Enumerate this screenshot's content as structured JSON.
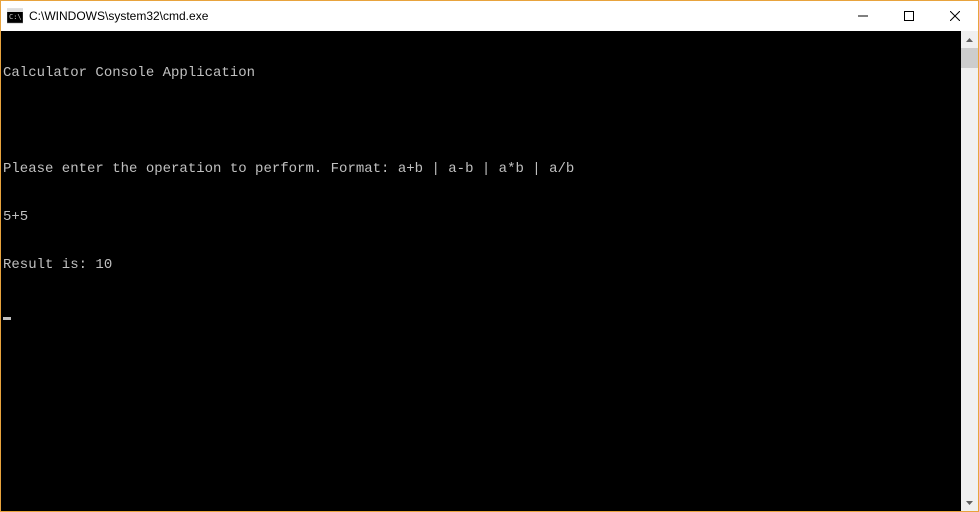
{
  "window": {
    "title": "C:\\WINDOWS\\system32\\cmd.exe"
  },
  "console": {
    "lines": [
      "Calculator Console Application",
      "",
      "Please enter the operation to perform. Format: a+b | a-b | a*b | a/b",
      "5+5",
      "Result is: 10"
    ]
  }
}
